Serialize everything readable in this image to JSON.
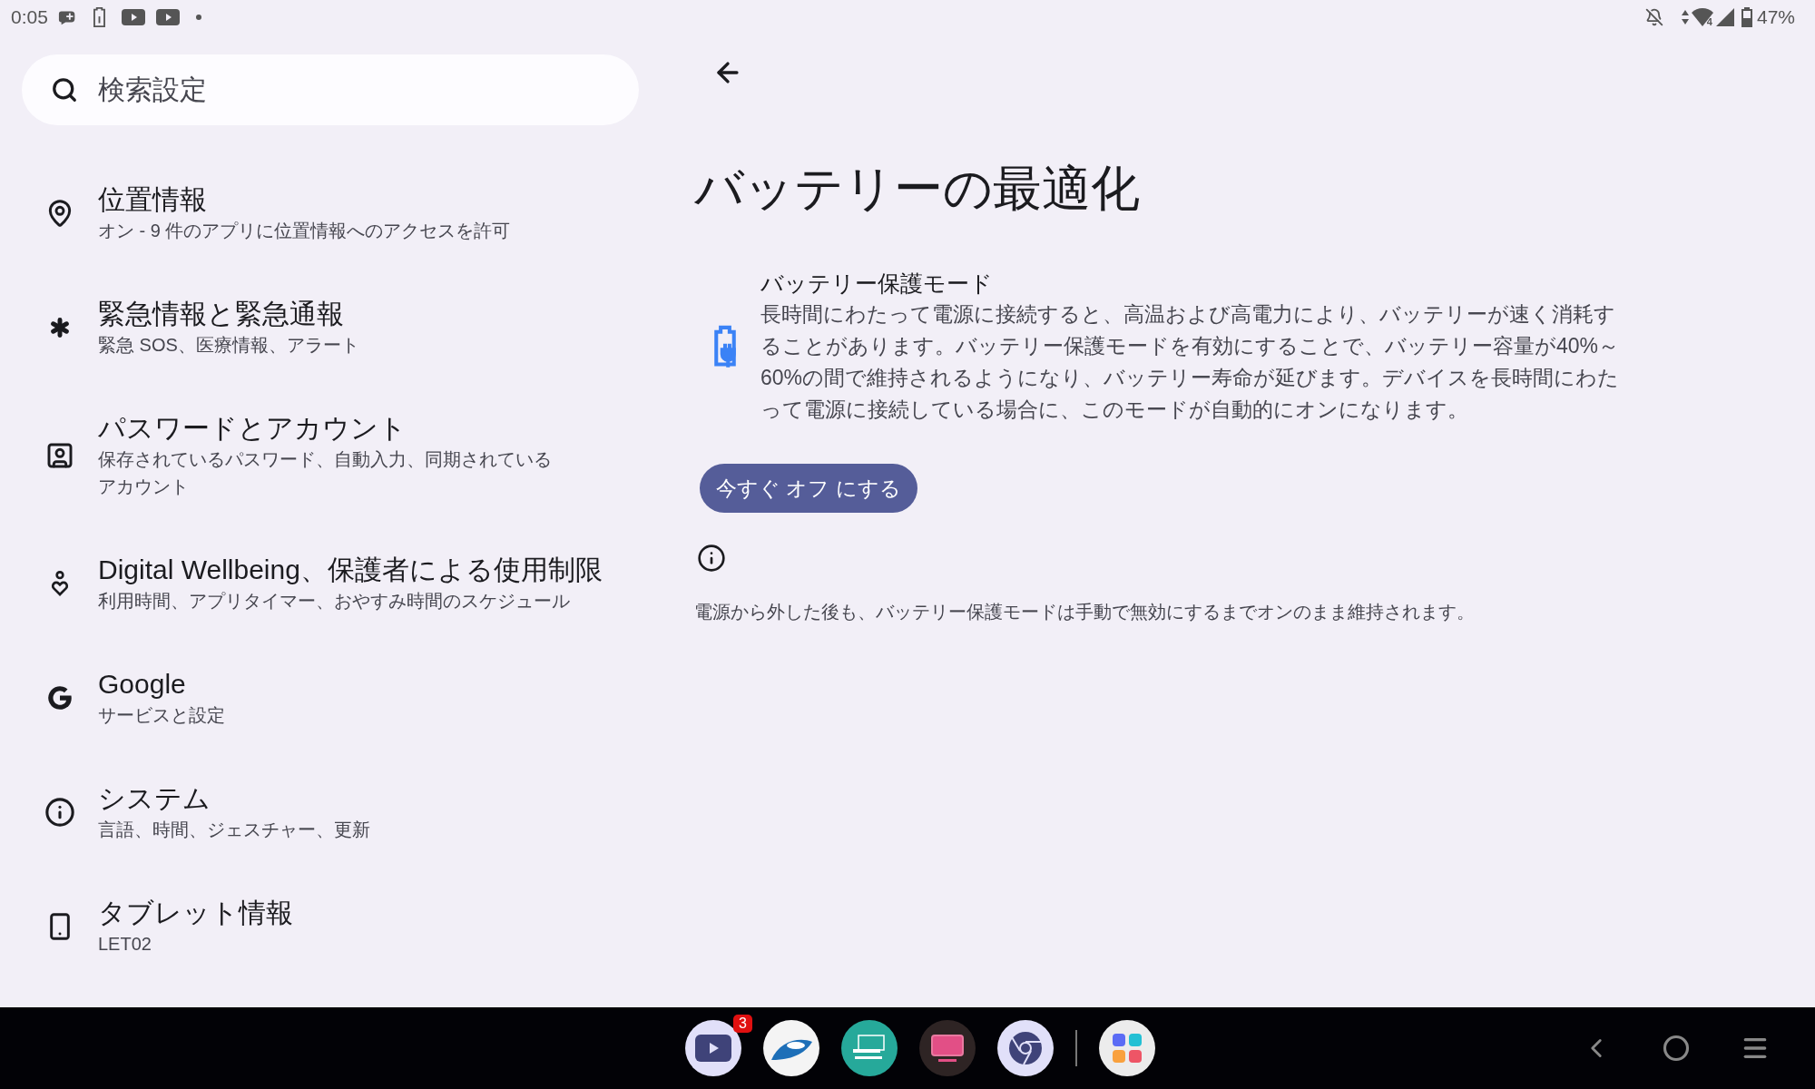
{
  "status_bar": {
    "time": "0:05",
    "wifi_label": "4",
    "battery": "47%"
  },
  "search": {
    "placeholder": "検索設定"
  },
  "settings": [
    {
      "title": "位置情報",
      "subtitle": "オン - 9 件のアプリに位置情報へのアクセスを許可"
    },
    {
      "title": "緊急情報と緊急通報",
      "subtitle": "緊急 SOS、医療情報、アラート"
    },
    {
      "title": "パスワードとアカウント",
      "subtitle": [
        "保存されているパスワード、自動入力、同期されている",
        "アカウント"
      ]
    },
    {
      "title": "Digital Wellbeing、保護者による使用制限",
      "subtitle": "利用時間、アプリタイマー、おやすみ時間のスケジュール"
    },
    {
      "title": "Google",
      "subtitle": "サービスと設定"
    },
    {
      "title": "システム",
      "subtitle": "言語、時間、ジェスチャー、更新"
    },
    {
      "title": "タブレット情報",
      "subtitle": "LET02"
    }
  ],
  "detail": {
    "title": "バッテリーの最適化",
    "section_title": "バッテリー保護モード",
    "section_body": "長時間にわたって電源に接続すると、高温および高電力により、バッテリーが速く消耗することがあります。バッテリー保護モードを有効にすることで、バッテリー容量が40%～60%の間で維持されるようになり、バッテリー寿命が延びます。デバイスを長時間にわたって電源に接続している場合に、このモードが自動的にオンになります。",
    "button": "今すぐ オフ にする",
    "footer": "電源から外した後も、バッテリー保護モードは手動で無効にするまでオンのまま維持されます。"
  },
  "taskbar": {
    "badge": "3"
  }
}
